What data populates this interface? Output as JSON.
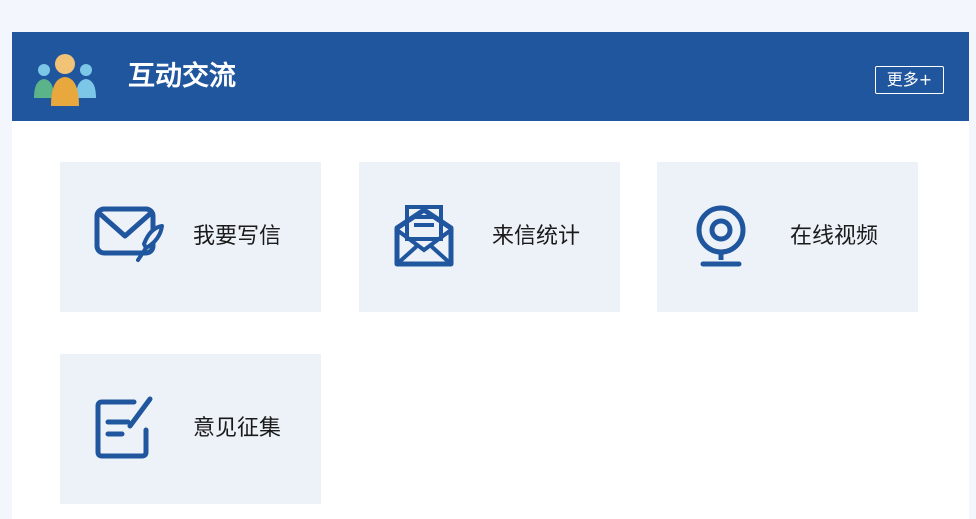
{
  "header": {
    "title": "互动交流",
    "more_label": "更多+",
    "logo_icon": "people-group-icon"
  },
  "colors": {
    "header_bg": "#1f569e",
    "tile_bg": "#edf2f9",
    "icon_blue": "#1f569e",
    "page_bg": "#f3f7fd"
  },
  "tiles": [
    {
      "label": "我要写信",
      "icon": "envelope-pen-icon"
    },
    {
      "label": "来信统计",
      "icon": "open-letter-icon"
    },
    {
      "label": "在线视频",
      "icon": "webcam-icon"
    },
    {
      "label": "意见征集",
      "icon": "edit-note-icon"
    }
  ]
}
